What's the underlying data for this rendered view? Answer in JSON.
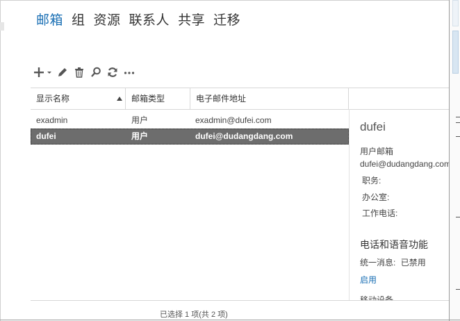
{
  "tabs": [
    {
      "label": "邮箱",
      "active": true
    },
    {
      "label": "组"
    },
    {
      "label": "资源"
    },
    {
      "label": "联系人"
    },
    {
      "label": "共享"
    },
    {
      "label": "迁移"
    }
  ],
  "toolbar": {
    "icons": [
      "add-icon",
      "edit-icon",
      "delete-icon",
      "search-icon",
      "refresh-icon",
      "more-icon"
    ]
  },
  "table": {
    "columns": [
      "显示名称",
      "邮箱类型",
      "电子邮件地址"
    ],
    "rows": [
      {
        "name": "exadmin",
        "type": "用户",
        "email": "exadmin@dufei.com"
      },
      {
        "name": "dufei",
        "type": "用户",
        "email": "dufei@dudangdang.com",
        "selected": true
      }
    ]
  },
  "details": {
    "name": "dufei",
    "mailbox_label": "用户邮箱",
    "email": "dufei@dudangdang.com",
    "title_label": "职务:",
    "office_label": "办公室:",
    "phone_label": "工作电话:",
    "section_title": "电话和语音功能",
    "um_label": "统一消息:",
    "um_value": "已禁用",
    "enable_link": "启用",
    "mobile_label": "移动设备"
  },
  "status": "已选择 1 项(共 2 项)",
  "colors": {
    "accent": "#1a6fb4",
    "selected_row": "#6d6d6d"
  }
}
